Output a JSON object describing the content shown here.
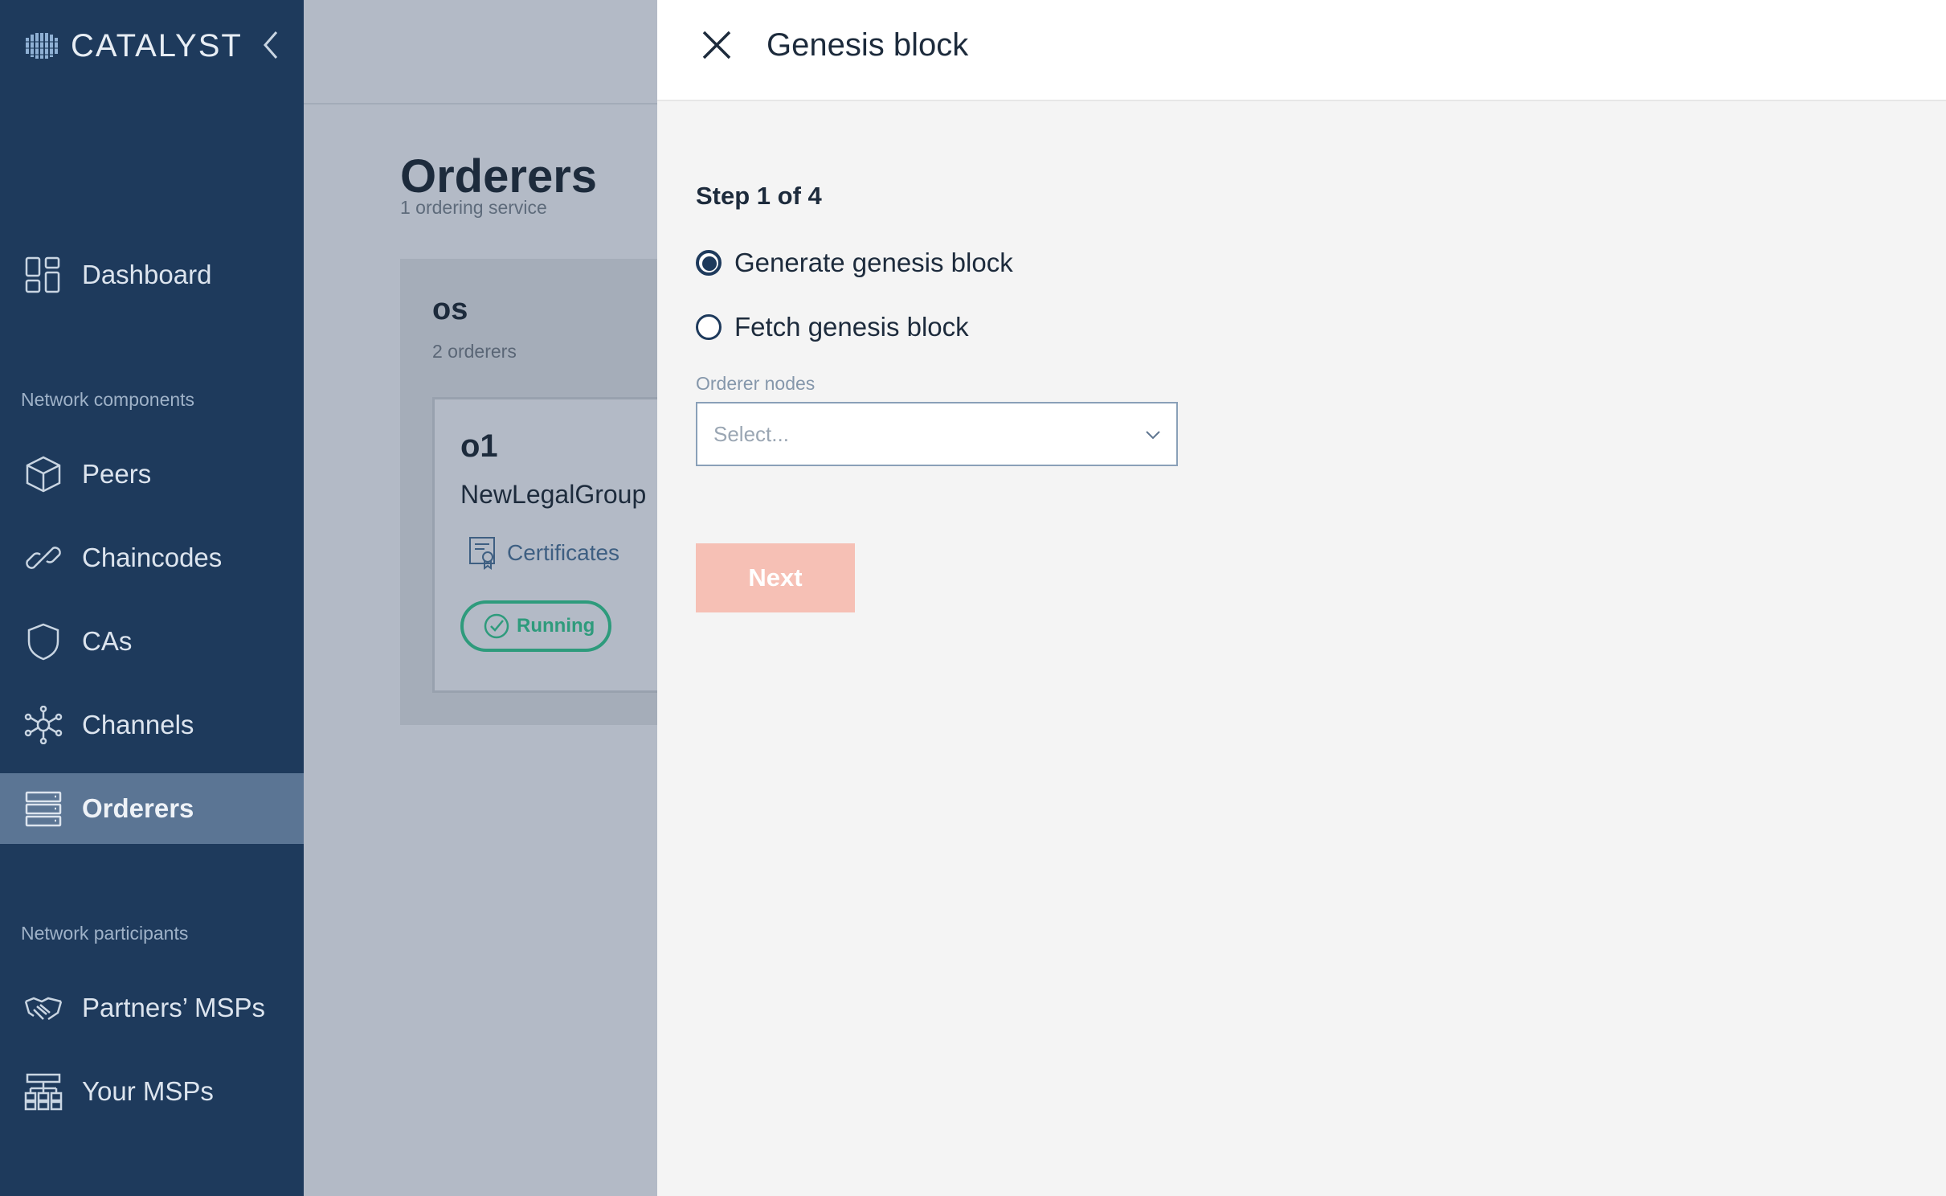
{
  "sidebar": {
    "brand": "CATALYST",
    "sections": {
      "network_components": "Network components",
      "network_participants": "Network participants"
    },
    "items": [
      {
        "label": "Dashboard",
        "icon": "dashboard-icon"
      },
      {
        "label": "Peers",
        "icon": "cube-icon"
      },
      {
        "label": "Chaincodes",
        "icon": "link-icon"
      },
      {
        "label": "CAs",
        "icon": "shield-icon"
      },
      {
        "label": "Channels",
        "icon": "network-hub-icon"
      },
      {
        "label": "Orderers",
        "icon": "server-stack-icon",
        "active": true
      },
      {
        "label": "Partners’ MSPs",
        "icon": "handshake-icon"
      },
      {
        "label": "Your MSPs",
        "icon": "org-chart-icon"
      }
    ]
  },
  "page": {
    "title": "Orderers",
    "subtitle": "1 ordering service",
    "service": {
      "name": "os",
      "count": "2 orderers",
      "node": {
        "name": "o1",
        "org": "NewLegalGroup",
        "certificates_label": "Certificates",
        "status": "Running"
      }
    }
  },
  "drawer": {
    "title": "Genesis block",
    "step": "Step 1 of 4",
    "options": [
      {
        "label": "Generate genesis block",
        "checked": true
      },
      {
        "label": "Fetch genesis block",
        "checked": false
      }
    ],
    "orderer_nodes_label": "Orderer nodes",
    "orderer_nodes_placeholder": "Select...",
    "next_label": "Next"
  },
  "colors": {
    "sidebar": "#1e3a5c",
    "sidebar_active": "#5b7594",
    "overlay": "#b3bac6",
    "drawer_bg": "#f4f4f4",
    "next_disabled": "#f6c0b5",
    "status_running": "#2e9b7c"
  }
}
